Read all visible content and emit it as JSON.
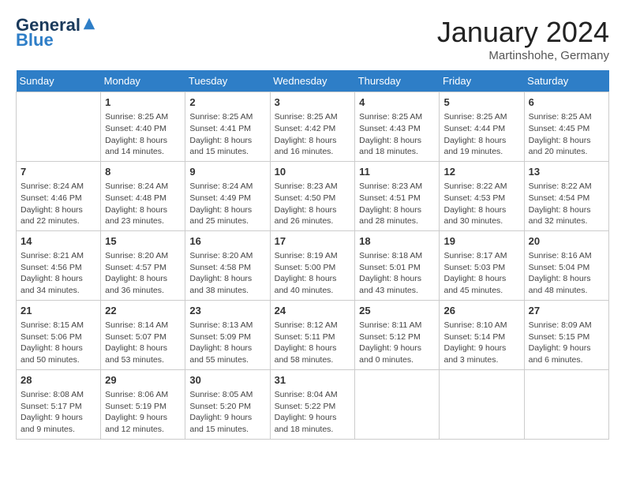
{
  "header": {
    "logo_line1": "General",
    "logo_line2": "Blue",
    "month_title": "January 2024",
    "location": "Martinshohe, Germany"
  },
  "weekdays": [
    "Sunday",
    "Monday",
    "Tuesday",
    "Wednesday",
    "Thursday",
    "Friday",
    "Saturday"
  ],
  "weeks": [
    [
      {
        "day": "",
        "info": ""
      },
      {
        "day": "1",
        "info": "Sunrise: 8:25 AM\nSunset: 4:40 PM\nDaylight: 8 hours\nand 14 minutes."
      },
      {
        "day": "2",
        "info": "Sunrise: 8:25 AM\nSunset: 4:41 PM\nDaylight: 8 hours\nand 15 minutes."
      },
      {
        "day": "3",
        "info": "Sunrise: 8:25 AM\nSunset: 4:42 PM\nDaylight: 8 hours\nand 16 minutes."
      },
      {
        "day": "4",
        "info": "Sunrise: 8:25 AM\nSunset: 4:43 PM\nDaylight: 8 hours\nand 18 minutes."
      },
      {
        "day": "5",
        "info": "Sunrise: 8:25 AM\nSunset: 4:44 PM\nDaylight: 8 hours\nand 19 minutes."
      },
      {
        "day": "6",
        "info": "Sunrise: 8:25 AM\nSunset: 4:45 PM\nDaylight: 8 hours\nand 20 minutes."
      }
    ],
    [
      {
        "day": "7",
        "info": "Sunrise: 8:24 AM\nSunset: 4:46 PM\nDaylight: 8 hours\nand 22 minutes."
      },
      {
        "day": "8",
        "info": "Sunrise: 8:24 AM\nSunset: 4:48 PM\nDaylight: 8 hours\nand 23 minutes."
      },
      {
        "day": "9",
        "info": "Sunrise: 8:24 AM\nSunset: 4:49 PM\nDaylight: 8 hours\nand 25 minutes."
      },
      {
        "day": "10",
        "info": "Sunrise: 8:23 AM\nSunset: 4:50 PM\nDaylight: 8 hours\nand 26 minutes."
      },
      {
        "day": "11",
        "info": "Sunrise: 8:23 AM\nSunset: 4:51 PM\nDaylight: 8 hours\nand 28 minutes."
      },
      {
        "day": "12",
        "info": "Sunrise: 8:22 AM\nSunset: 4:53 PM\nDaylight: 8 hours\nand 30 minutes."
      },
      {
        "day": "13",
        "info": "Sunrise: 8:22 AM\nSunset: 4:54 PM\nDaylight: 8 hours\nand 32 minutes."
      }
    ],
    [
      {
        "day": "14",
        "info": "Sunrise: 8:21 AM\nSunset: 4:56 PM\nDaylight: 8 hours\nand 34 minutes."
      },
      {
        "day": "15",
        "info": "Sunrise: 8:20 AM\nSunset: 4:57 PM\nDaylight: 8 hours\nand 36 minutes."
      },
      {
        "day": "16",
        "info": "Sunrise: 8:20 AM\nSunset: 4:58 PM\nDaylight: 8 hours\nand 38 minutes."
      },
      {
        "day": "17",
        "info": "Sunrise: 8:19 AM\nSunset: 5:00 PM\nDaylight: 8 hours\nand 40 minutes."
      },
      {
        "day": "18",
        "info": "Sunrise: 8:18 AM\nSunset: 5:01 PM\nDaylight: 8 hours\nand 43 minutes."
      },
      {
        "day": "19",
        "info": "Sunrise: 8:17 AM\nSunset: 5:03 PM\nDaylight: 8 hours\nand 45 minutes."
      },
      {
        "day": "20",
        "info": "Sunrise: 8:16 AM\nSunset: 5:04 PM\nDaylight: 8 hours\nand 48 minutes."
      }
    ],
    [
      {
        "day": "21",
        "info": "Sunrise: 8:15 AM\nSunset: 5:06 PM\nDaylight: 8 hours\nand 50 minutes."
      },
      {
        "day": "22",
        "info": "Sunrise: 8:14 AM\nSunset: 5:07 PM\nDaylight: 8 hours\nand 53 minutes."
      },
      {
        "day": "23",
        "info": "Sunrise: 8:13 AM\nSunset: 5:09 PM\nDaylight: 8 hours\nand 55 minutes."
      },
      {
        "day": "24",
        "info": "Sunrise: 8:12 AM\nSunset: 5:11 PM\nDaylight: 8 hours\nand 58 minutes."
      },
      {
        "day": "25",
        "info": "Sunrise: 8:11 AM\nSunset: 5:12 PM\nDaylight: 9 hours\nand 0 minutes."
      },
      {
        "day": "26",
        "info": "Sunrise: 8:10 AM\nSunset: 5:14 PM\nDaylight: 9 hours\nand 3 minutes."
      },
      {
        "day": "27",
        "info": "Sunrise: 8:09 AM\nSunset: 5:15 PM\nDaylight: 9 hours\nand 6 minutes."
      }
    ],
    [
      {
        "day": "28",
        "info": "Sunrise: 8:08 AM\nSunset: 5:17 PM\nDaylight: 9 hours\nand 9 minutes."
      },
      {
        "day": "29",
        "info": "Sunrise: 8:06 AM\nSunset: 5:19 PM\nDaylight: 9 hours\nand 12 minutes."
      },
      {
        "day": "30",
        "info": "Sunrise: 8:05 AM\nSunset: 5:20 PM\nDaylight: 9 hours\nand 15 minutes."
      },
      {
        "day": "31",
        "info": "Sunrise: 8:04 AM\nSunset: 5:22 PM\nDaylight: 9 hours\nand 18 minutes."
      },
      {
        "day": "",
        "info": ""
      },
      {
        "day": "",
        "info": ""
      },
      {
        "day": "",
        "info": ""
      }
    ]
  ]
}
